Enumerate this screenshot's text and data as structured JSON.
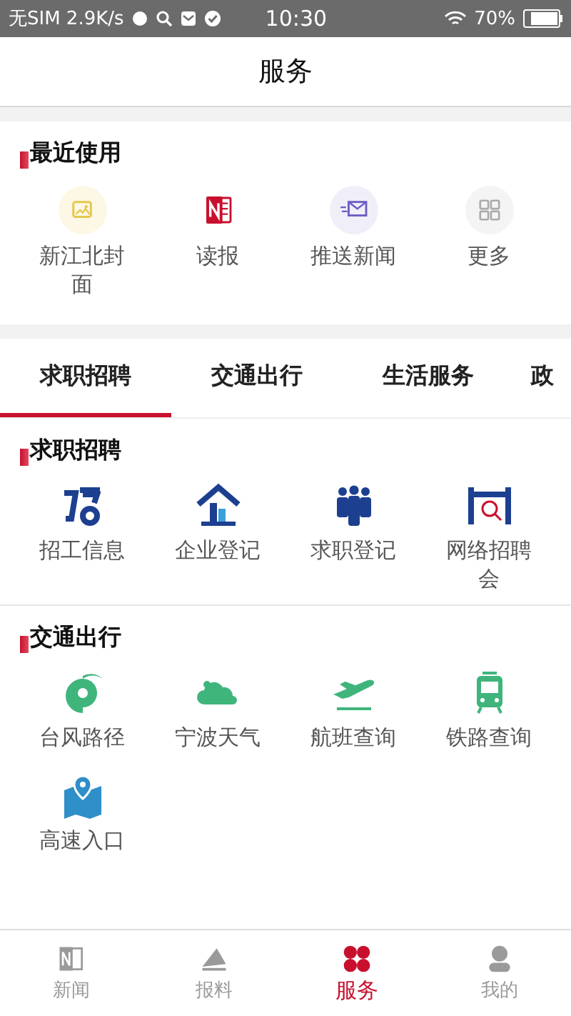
{
  "status_bar": {
    "carrier": "无SIM 2.9K/s",
    "time": "10:30",
    "battery": "70%"
  },
  "header": {
    "title": "服务"
  },
  "recent": {
    "title": "最近使用",
    "items": [
      "新江北封面",
      "读报",
      "推送新闻",
      "更多"
    ]
  },
  "tabs": [
    {
      "label": "求职招聘",
      "selected": true
    },
    {
      "label": "交通出行",
      "selected": false
    },
    {
      "label": "生活服务",
      "selected": false
    },
    {
      "label": "政",
      "selected": false
    }
  ],
  "sections": [
    {
      "title": "求职招聘",
      "items": [
        "招工信息",
        "企业登记",
        "求职登记",
        "网络招聘会"
      ]
    },
    {
      "title": "交通出行",
      "items": [
        "台风路径",
        "宁波天气",
        "航班查询",
        "铁路查询",
        "高速入口"
      ]
    }
  ],
  "bottom_nav": [
    {
      "label": "新闻",
      "selected": false
    },
    {
      "label": "报料",
      "selected": false
    },
    {
      "label": "服务",
      "selected": true
    },
    {
      "label": "我的",
      "selected": false
    }
  ]
}
